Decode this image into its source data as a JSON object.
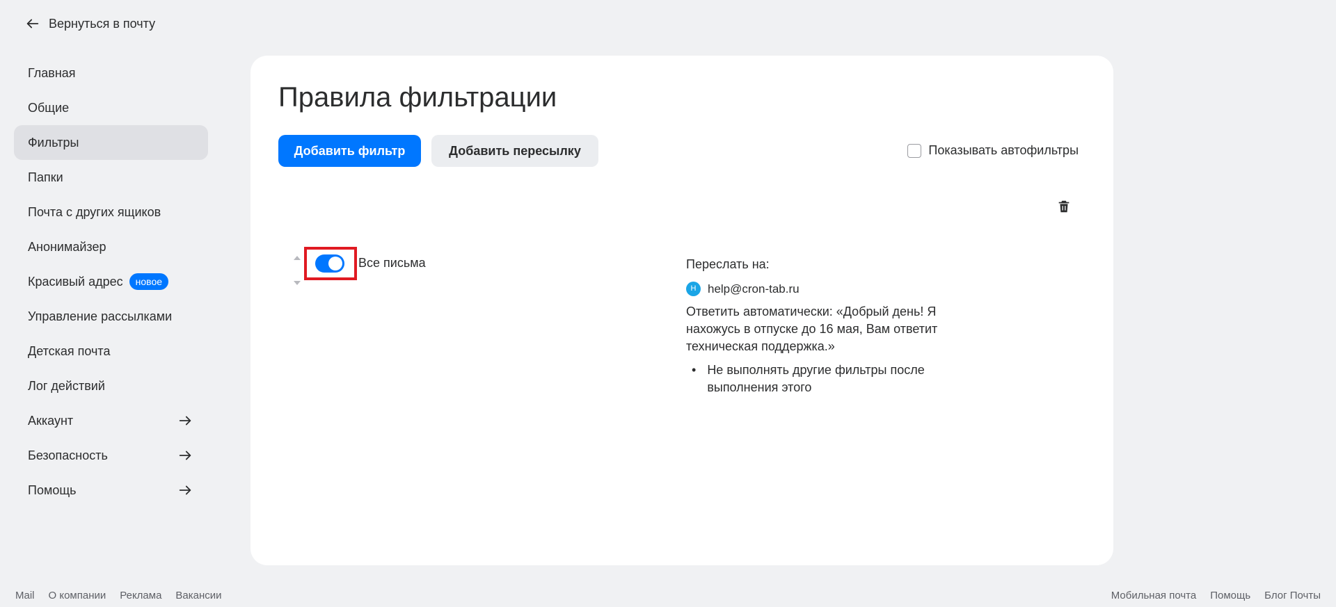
{
  "back_link": "Вернуться в почту",
  "sidebar": {
    "items": [
      {
        "label": "Главная"
      },
      {
        "label": "Общие"
      },
      {
        "label": "Фильтры"
      },
      {
        "label": "Папки"
      },
      {
        "label": "Почта с других ящиков"
      },
      {
        "label": "Анонимайзер"
      },
      {
        "label": "Красивый адрес",
        "badge": "новое"
      },
      {
        "label": "Управление рассылками"
      },
      {
        "label": "Детская почта"
      },
      {
        "label": "Лог действий"
      },
      {
        "label": "Аккаунт"
      },
      {
        "label": "Безопасность"
      },
      {
        "label": "Помощь"
      }
    ],
    "active": "Фильтры"
  },
  "main": {
    "title": "Правила фильтрации",
    "add_filter_button": "Добавить фильтр",
    "add_forward_button": "Добавить пересылку",
    "show_autofilters_label": "Показывать автофильтры",
    "show_autofilters_checked": false
  },
  "filter": {
    "enabled": true,
    "name": "Все письма",
    "forward_label": "Переслать на:",
    "avatar_letter": "H",
    "email": "help@cron-tab.ru",
    "autoreply": "Ответить автоматически: «Добрый день! Я нахожусь в отпуске до 16 мая, Вам ответит техническая поддержка.»",
    "bullet": "Не выполнять другие фильтры после выполнения этого"
  },
  "footer": {
    "left": [
      "Mail",
      "О компании",
      "Реклама",
      "Вакансии"
    ],
    "right": [
      "Мобильная почта",
      "Помощь",
      "Блог Почты"
    ]
  },
  "colors": {
    "accent": "#0077ff",
    "highlight": "#e01a22",
    "background": "#f0f1f3"
  }
}
